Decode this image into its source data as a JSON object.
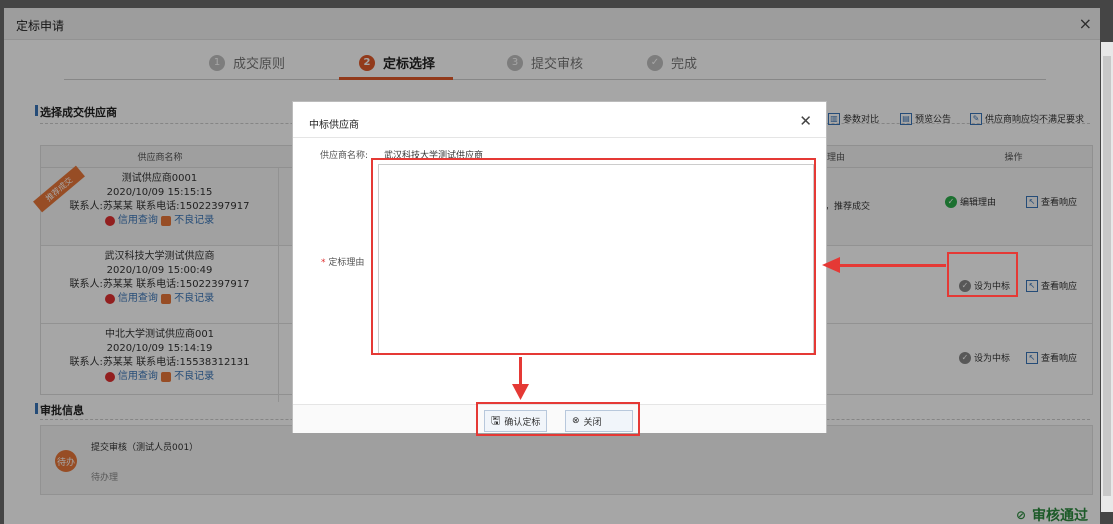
{
  "window": {
    "title": "定标申请",
    "close": "×"
  },
  "steps": [
    {
      "num": "1",
      "label": "成交原则",
      "active": false
    },
    {
      "num": "2",
      "label": "定标选择",
      "active": true
    },
    {
      "num": "3",
      "label": "提交审核",
      "active": false
    },
    {
      "num": "✓",
      "label": "完成",
      "active": false
    }
  ],
  "section_select": "选择成交供应商",
  "toolbar": {
    "compare": "参数对比",
    "preview": "预览公告",
    "not_meet": "供应商响应均不满足要求"
  },
  "table": {
    "headers": {
      "supplier": "供应商名称",
      "reason": "定标理由",
      "ops": "操作"
    },
    "rows": [
      {
        "name": "测试供应商0001",
        "time": "2020/10/09 15:15:15",
        "contact": "联系人:苏某某 联系电话:15022397917",
        "credit": "信用查询",
        "bad": "不良记录",
        "badge": "推荐成交",
        "reason": "低，推荐成交",
        "op1": "编辑理由",
        "op2": "查看响应"
      },
      {
        "name": "武汉科技大学测试供应商",
        "time": "2020/10/09 15:00:49",
        "contact": "联系人:苏某某 联系电话:15022397917",
        "credit": "信用查询",
        "bad": "不良记录",
        "badge": "",
        "reason": "",
        "op1": "设为中标",
        "op2": "查看响应"
      },
      {
        "name": "中北大学测试供应商001",
        "time": "2020/10/09 15:14:19",
        "contact": "联系人:苏某某 联系电话:15538312131",
        "credit": "信用查询",
        "bad": "不良记录",
        "badge": "",
        "reason": "",
        "op1": "设为中标",
        "op2": "查看响应"
      }
    ]
  },
  "section_approval": "审批信息",
  "approval": {
    "status": "待办",
    "title": "提交审核（测试人员001）",
    "sub": "待办理"
  },
  "pass": "审核通过",
  "modal": {
    "title": "中标供应商",
    "supplier_label": "供应商名称:",
    "supplier_value": "武汉科技大学测试供应商",
    "reason_label": "定标理由",
    "reason_value": "",
    "confirm": "确认定标",
    "close": "关闭"
  },
  "colors": {
    "accent": "#e05a2a",
    "highlight": "#e53935",
    "success": "#2bac4b"
  }
}
